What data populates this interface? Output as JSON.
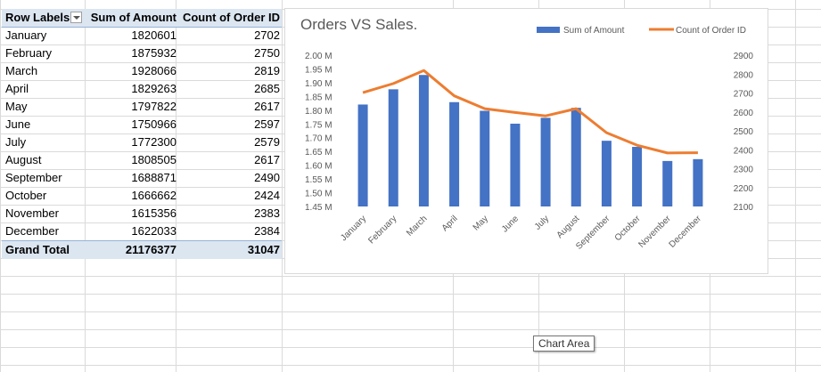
{
  "pivot": {
    "headers": [
      "Row Labels",
      "Sum of Amount",
      "Count of Order ID"
    ],
    "rows": [
      {
        "label": "January",
        "amount": "1820601",
        "count": "2702"
      },
      {
        "label": "February",
        "amount": "1875932",
        "count": "2750"
      },
      {
        "label": "March",
        "amount": "1928066",
        "count": "2819"
      },
      {
        "label": "April",
        "amount": "1829263",
        "count": "2685"
      },
      {
        "label": "May",
        "amount": "1797822",
        "count": "2617"
      },
      {
        "label": "June",
        "amount": "1750966",
        "count": "2597"
      },
      {
        "label": "July",
        "amount": "1772300",
        "count": "2579"
      },
      {
        "label": "August",
        "amount": "1808505",
        "count": "2617"
      },
      {
        "label": "September",
        "amount": "1688871",
        "count": "2490"
      },
      {
        "label": "October",
        "amount": "1666662",
        "count": "2424"
      },
      {
        "label": "November",
        "amount": "1615356",
        "count": "2383"
      },
      {
        "label": "December",
        "amount": "1622033",
        "count": "2384"
      }
    ],
    "total": {
      "label": "Grand Total",
      "amount": "21176377",
      "count": "31047"
    }
  },
  "tooltip": "Chart Area",
  "chart_data": {
    "type": "bar",
    "title": "Orders VS Sales.",
    "categories": [
      "January",
      "February",
      "March",
      "April",
      "May",
      "June",
      "July",
      "August",
      "September",
      "October",
      "November",
      "December"
    ],
    "series": [
      {
        "name": "Sum of Amount",
        "type": "bar",
        "axis": "left",
        "color": "#4472c4",
        "values": [
          1820601,
          1875932,
          1928066,
          1829263,
          1797822,
          1750966,
          1772300,
          1808505,
          1688871,
          1666662,
          1615356,
          1622033
        ]
      },
      {
        "name": "Count of Order ID",
        "type": "line",
        "axis": "right",
        "color": "#ed7d31",
        "values": [
          2702,
          2750,
          2819,
          2685,
          2617,
          2597,
          2579,
          2617,
          2490,
          2424,
          2383,
          2384
        ]
      }
    ],
    "y_left": {
      "min": 1450000,
      "max": 2000000,
      "ticks": [
        "2.00 M",
        "1.95 M",
        "1.90 M",
        "1.85 M",
        "1.80 M",
        "1.75 M",
        "1.70 M",
        "1.65 M",
        "1.60 M",
        "1.55 M",
        "1.50 M",
        "1.45 M"
      ]
    },
    "y_right": {
      "min": 2100,
      "max": 2900,
      "ticks": [
        "2900",
        "2800",
        "2700",
        "2600",
        "2500",
        "2400",
        "2300",
        "2200",
        "2100"
      ]
    },
    "legend_position": "top-right",
    "grid": false
  }
}
